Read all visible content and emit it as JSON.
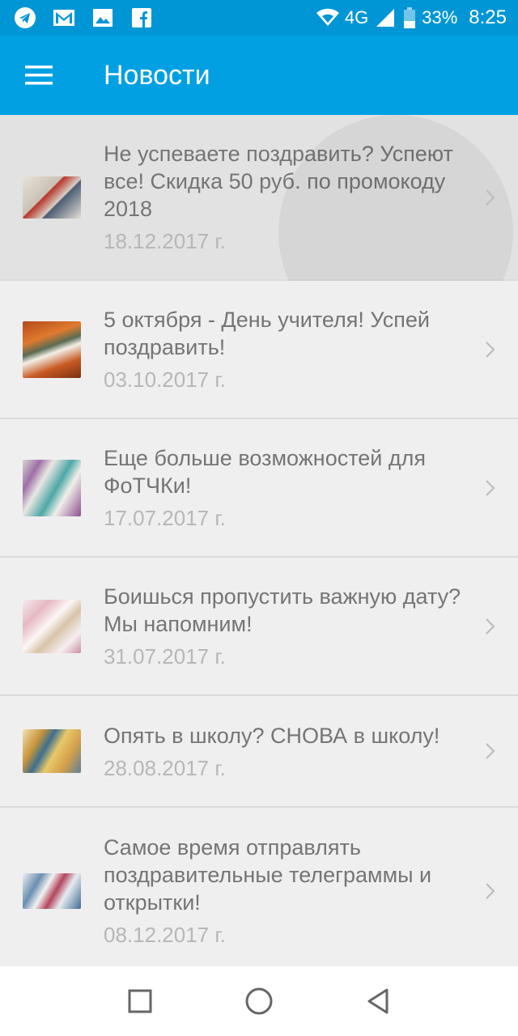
{
  "statusbar": {
    "network": "4G",
    "battery": "33%",
    "time": "8:25",
    "icons": [
      "telegram-icon",
      "gmail-icon",
      "image-icon",
      "facebook-icon",
      "wifi-icon",
      "signal-icon",
      "battery-icon"
    ]
  },
  "appbar": {
    "title": "Новости",
    "menu_icon": "hamburger-menu-icon"
  },
  "news": [
    {
      "title": "Не успеваете поздравить? Успеют все! Скидка 50 руб. по промокоду 2018",
      "date": "18.12.2017 г."
    },
    {
      "title": "5 октября - День учителя! Успей поздравить!",
      "date": "03.10.2017 г."
    },
    {
      "title": "Еще больше возможностей для ФоТЧКи!",
      "date": "17.07.2017 г."
    },
    {
      "title": "Боишься пропустить важную дату? Мы напомним!",
      "date": "31.07.2017 г."
    },
    {
      "title": "Опять в школу? СНОВА в школу!",
      "date": "28.08.2017 г."
    },
    {
      "title": "Самое время отправлять поздравительные телеграммы и открытки!",
      "date": "08.12.2017 г."
    }
  ],
  "navbar": {
    "buttons": [
      "recent-apps-icon",
      "home-icon",
      "back-icon"
    ]
  },
  "colors": {
    "statusbar": "#0096d6",
    "appbar": "#00a0e3",
    "list_bg": "#efefef",
    "title_text": "#757575",
    "date_text": "#b7b7b7"
  }
}
